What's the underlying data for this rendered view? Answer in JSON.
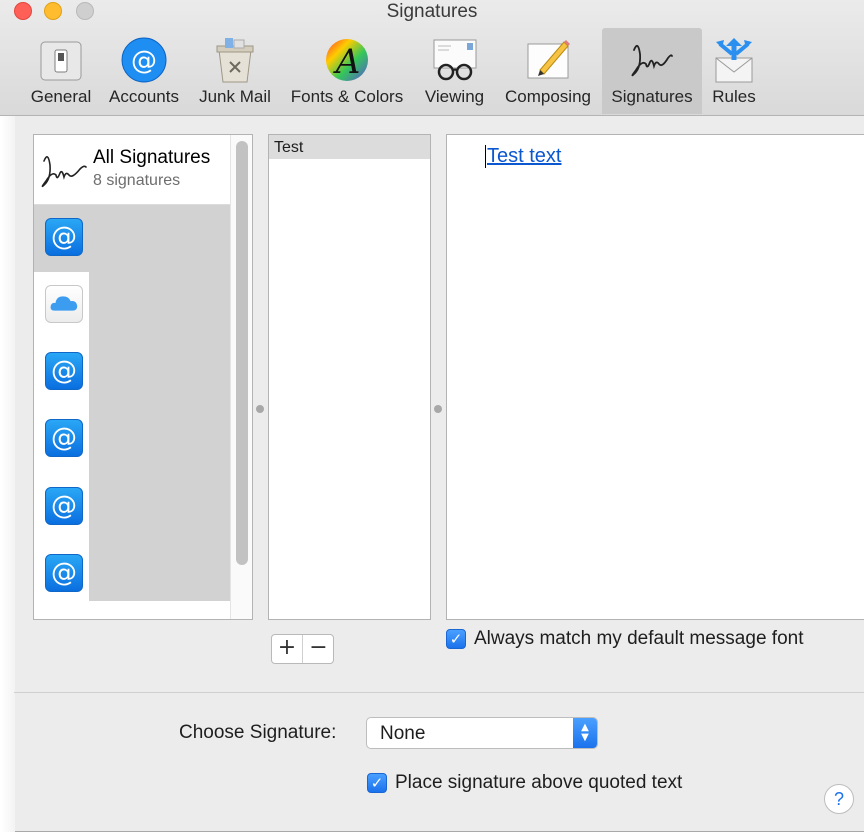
{
  "window": {
    "title": "Signatures"
  },
  "toolbar": {
    "items": [
      {
        "label": "General",
        "icon": "general-switch-icon"
      },
      {
        "label": "Accounts",
        "icon": "at-sign-icon"
      },
      {
        "label": "Junk Mail",
        "icon": "trash-can-icon"
      },
      {
        "label": "Fonts & Colors",
        "icon": "font-color-wheel-icon"
      },
      {
        "label": "Viewing",
        "icon": "glasses-envelope-icon"
      },
      {
        "label": "Composing",
        "icon": "pencil-paper-icon"
      },
      {
        "label": "Signatures",
        "icon": "signature-icon",
        "selected": true
      },
      {
        "label": "Rules",
        "icon": "rules-envelope-icon"
      }
    ]
  },
  "signatures_panel": {
    "all_title": "All Signatures",
    "all_count": "8 signatures",
    "accounts": [
      {
        "icon": "at-sign-icon",
        "selected": true
      },
      {
        "icon": "icloud-icon"
      },
      {
        "icon": "at-sign-icon"
      },
      {
        "icon": "at-sign-icon"
      },
      {
        "icon": "at-sign-icon"
      },
      {
        "icon": "at-sign-icon"
      }
    ]
  },
  "names_panel": {
    "items": [
      "Test"
    ]
  },
  "editor": {
    "text": "Test text"
  },
  "buttons": {
    "add": "+",
    "remove": "−"
  },
  "options": {
    "match_font_label": "Always match my default message font",
    "match_font_checked": true,
    "choose_signature_label": "Choose Signature:",
    "choose_signature_value": "None",
    "place_above_label": "Place signature above quoted text",
    "place_above_checked": true
  },
  "help": {
    "label": "?"
  },
  "colors": {
    "accent": "#1b72ec",
    "link": "#0b57d0",
    "close": "#fe5f57",
    "minimize": "#febc2e"
  }
}
